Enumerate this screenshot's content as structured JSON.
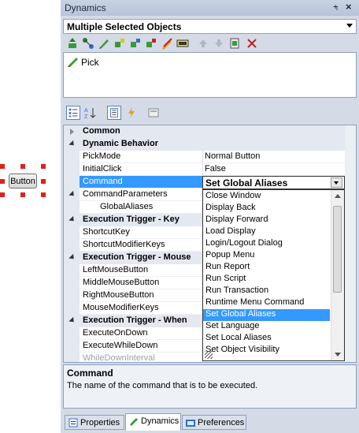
{
  "canvas": {
    "button_label": "Button"
  },
  "panel": {
    "title": "Dynamics",
    "pin_glyph": "⨧",
    "close_glyph": "×",
    "object_selector": "Multiple Selected Objects",
    "event_item": "Pick"
  },
  "toolbar_icons": [
    "add-event-icon",
    "connect-icon",
    "pick-icon",
    "action-icon",
    "action-icon",
    "action-icon",
    "highlight-icon",
    "script-icon",
    "move-up-icon",
    "move-down-icon",
    "paste-icon",
    "delete-icon"
  ],
  "grid": {
    "rows": [
      {
        "type": "cat",
        "expanded": false,
        "name": "Common",
        "value": ""
      },
      {
        "type": "cat",
        "expanded": true,
        "name": "Dynamic Behavior",
        "value": ""
      },
      {
        "type": "prop",
        "name": "PickMode",
        "value": "Normal Button"
      },
      {
        "type": "prop",
        "name": "InitialClick",
        "value": "False"
      },
      {
        "type": "prop",
        "name": "Command",
        "value": "",
        "selected": true
      },
      {
        "type": "cat",
        "expanded": true,
        "name": "CommandParameters",
        "value": "",
        "subcat": true
      },
      {
        "type": "prop",
        "name": "GlobalAliases",
        "value": "",
        "indent": true
      },
      {
        "type": "cat",
        "expanded": true,
        "name": "Execution Trigger - Key",
        "value": ""
      },
      {
        "type": "prop",
        "name": "ShortcutKey",
        "value": ""
      },
      {
        "type": "prop",
        "name": "ShortcutModifierKeys",
        "value": ""
      },
      {
        "type": "cat",
        "expanded": true,
        "name": "Execution Trigger - Mouse",
        "value": ""
      },
      {
        "type": "prop",
        "name": "LeftMouseButton",
        "value": ""
      },
      {
        "type": "prop",
        "name": "MiddleMouseButton",
        "value": ""
      },
      {
        "type": "prop",
        "name": "RightMouseButton",
        "value": ""
      },
      {
        "type": "prop",
        "name": "MouseModifierKeys",
        "value": ""
      },
      {
        "type": "cat",
        "expanded": true,
        "name": "Execution Trigger - When",
        "value": ""
      },
      {
        "type": "prop",
        "name": "ExecuteOnDown",
        "value": ""
      },
      {
        "type": "prop",
        "name": "ExecuteWhileDown",
        "value": ""
      },
      {
        "type": "prop",
        "name": "WhileDownInterval",
        "value": "",
        "disabled": true
      }
    ]
  },
  "command_dropdown": {
    "selected": "Set Global Aliases",
    "options": [
      "Close Window",
      "Display Back",
      "Display Forward",
      "Load Display",
      "Login/Logout Dialog",
      "Popup Menu",
      "Run Report",
      "Run Script",
      "Run Transaction",
      "Runtime Menu Command",
      "Set Global Aliases",
      "Set Language",
      "Set Local Aliases",
      "Set Object Visibility"
    ]
  },
  "description": {
    "title": "Command",
    "text": "The name of the command that is to be executed."
  },
  "tabs": [
    {
      "label": "Properties",
      "active": false
    },
    {
      "label": "Dynamics",
      "active": true
    },
    {
      "label": "Preferences",
      "active": false
    }
  ]
}
